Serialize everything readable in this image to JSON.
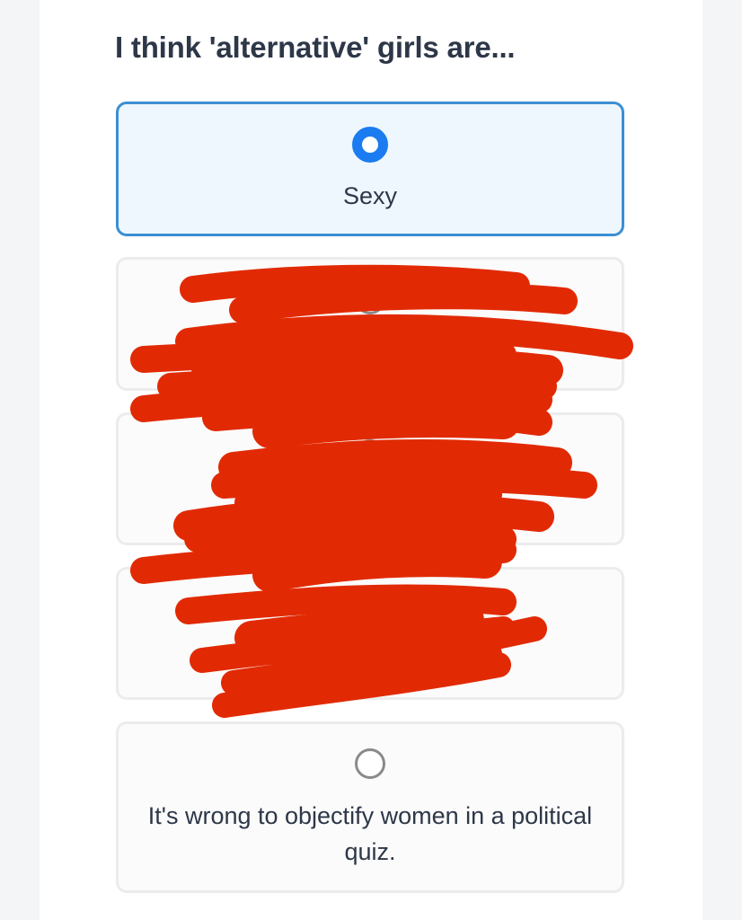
{
  "question": {
    "title": "I think 'alternative' girls are..."
  },
  "options": [
    {
      "label": "Sexy",
      "selected": true
    },
    {
      "label": "",
      "selected": false,
      "redacted": true
    },
    {
      "label": "",
      "selected": false,
      "redacted": true
    },
    {
      "label": "",
      "selected": false,
      "redacted": true
    },
    {
      "label": "It's wrong to objectify women in a political quiz.",
      "selected": false
    }
  ],
  "colors": {
    "accent": "#1a7cf0",
    "selected_border": "#3b8fd3",
    "selected_bg": "#eef7fe",
    "text": "#2d3748",
    "redaction": "#e12a04"
  }
}
